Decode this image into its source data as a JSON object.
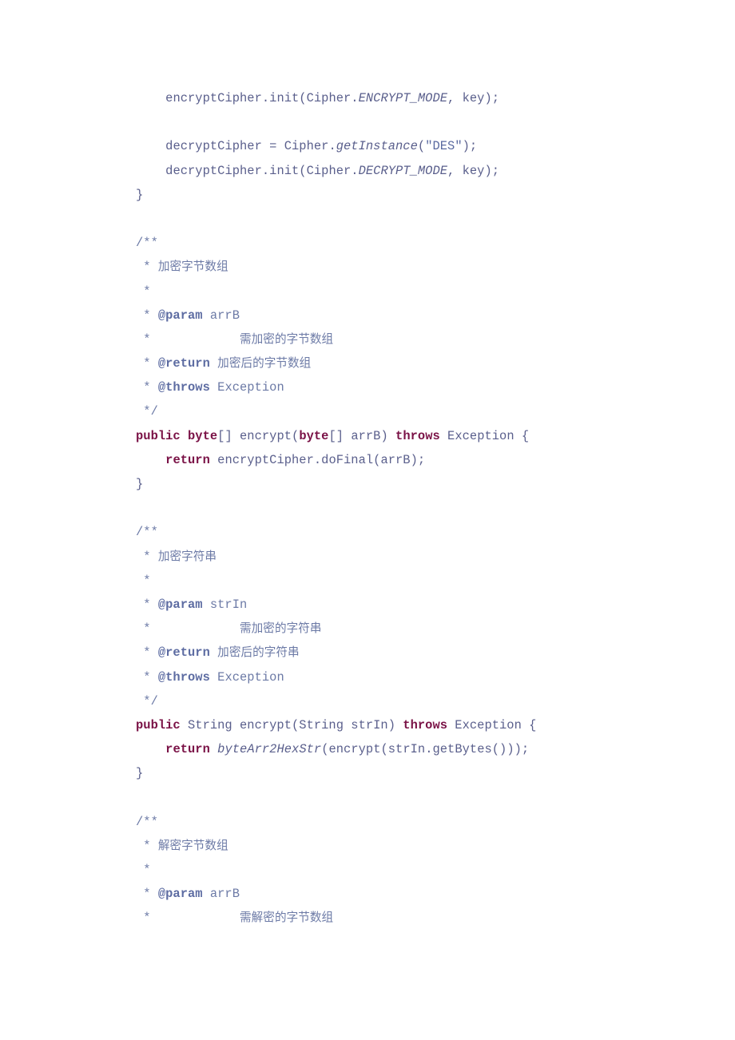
{
  "document": {
    "kind": "source-code-listing",
    "language": "Java",
    "background_color": "#ffffff",
    "colors": {
      "code": "#5a5f8c",
      "keyword": "#7a1246",
      "comment": "#6c7aa6",
      "comment_tag": "#5d6ca2",
      "string": "#5a6aa0"
    }
  },
  "lines": [
    {
      "id": "l01",
      "indent": 1,
      "tokens": [
        {
          "text": "encryptCipher.init(Cipher.",
          "style": "plain"
        },
        {
          "text": "ENCRYPT_MODE",
          "style": "static"
        },
        {
          "text": ", key);",
          "style": "plain"
        }
      ]
    },
    {
      "id": "l02",
      "indent": 0,
      "tokens": []
    },
    {
      "id": "l03",
      "indent": 1,
      "tokens": [
        {
          "text": "decryptCipher = Cipher.",
          "style": "plain"
        },
        {
          "text": "getInstance",
          "style": "static"
        },
        {
          "text": "(",
          "style": "plain"
        },
        {
          "text": "\"DES\"",
          "style": "string"
        },
        {
          "text": ");",
          "style": "plain"
        }
      ]
    },
    {
      "id": "l04",
      "indent": 1,
      "tokens": [
        {
          "text": "decryptCipher.init(Cipher.",
          "style": "plain"
        },
        {
          "text": "DECRYPT_MODE",
          "style": "static"
        },
        {
          "text": ", key);",
          "style": "plain"
        }
      ]
    },
    {
      "id": "l05",
      "indent": 0,
      "tokens": [
        {
          "text": "}",
          "style": "plain"
        }
      ]
    },
    {
      "id": "l06",
      "indent": 0,
      "tokens": []
    },
    {
      "id": "l07",
      "indent": 0,
      "tokens": [
        {
          "text": "/**",
          "style": "comment"
        }
      ]
    },
    {
      "id": "l08",
      "indent": 0,
      "tokens": [
        {
          "text": " * ",
          "style": "comment"
        },
        {
          "text": "加密字节数组",
          "style": "comment-cjk"
        }
      ]
    },
    {
      "id": "l09",
      "indent": 0,
      "tokens": [
        {
          "text": " *",
          "style": "comment"
        }
      ]
    },
    {
      "id": "l10",
      "indent": 0,
      "tokens": [
        {
          "text": " * ",
          "style": "comment"
        },
        {
          "text": "@param",
          "style": "comment-tag"
        },
        {
          "text": " arrB",
          "style": "comment"
        }
      ]
    },
    {
      "id": "l11",
      "indent": 0,
      "tokens": [
        {
          "text": " *            ",
          "style": "comment"
        },
        {
          "text": "需加密的字节数组",
          "style": "comment-cjk"
        }
      ]
    },
    {
      "id": "l12",
      "indent": 0,
      "tokens": [
        {
          "text": " * ",
          "style": "comment"
        },
        {
          "text": "@return",
          "style": "comment-tag"
        },
        {
          "text": " ",
          "style": "comment"
        },
        {
          "text": "加密后的字节数组",
          "style": "comment-cjk"
        }
      ]
    },
    {
      "id": "l13",
      "indent": 0,
      "tokens": [
        {
          "text": " * ",
          "style": "comment"
        },
        {
          "text": "@throws",
          "style": "comment-tag"
        },
        {
          "text": " Exception",
          "style": "comment"
        }
      ]
    },
    {
      "id": "l14",
      "indent": 0,
      "tokens": [
        {
          "text": " */",
          "style": "comment"
        }
      ]
    },
    {
      "id": "l15",
      "indent": 0,
      "tokens": [
        {
          "text": "public byte",
          "style": "keyword"
        },
        {
          "text": "[] encrypt(",
          "style": "plain"
        },
        {
          "text": "byte",
          "style": "keyword"
        },
        {
          "text": "[] arrB) ",
          "style": "plain"
        },
        {
          "text": "throws",
          "style": "keyword"
        },
        {
          "text": " Exception {",
          "style": "plain"
        }
      ]
    },
    {
      "id": "l16",
      "indent": 1,
      "tokens": [
        {
          "text": "return",
          "style": "keyword"
        },
        {
          "text": " encryptCipher.doFinal(arrB);",
          "style": "plain"
        }
      ]
    },
    {
      "id": "l17",
      "indent": 0,
      "tokens": [
        {
          "text": "}",
          "style": "plain"
        }
      ]
    },
    {
      "id": "l18",
      "indent": 0,
      "tokens": []
    },
    {
      "id": "l19",
      "indent": 0,
      "tokens": [
        {
          "text": "/**",
          "style": "comment"
        }
      ]
    },
    {
      "id": "l20",
      "indent": 0,
      "tokens": [
        {
          "text": " * ",
          "style": "comment"
        },
        {
          "text": "加密字符串",
          "style": "comment-cjk"
        }
      ]
    },
    {
      "id": "l21",
      "indent": 0,
      "tokens": [
        {
          "text": " *",
          "style": "comment"
        }
      ]
    },
    {
      "id": "l22",
      "indent": 0,
      "tokens": [
        {
          "text": " * ",
          "style": "comment"
        },
        {
          "text": "@param",
          "style": "comment-tag"
        },
        {
          "text": " strIn",
          "style": "comment"
        }
      ]
    },
    {
      "id": "l23",
      "indent": 0,
      "tokens": [
        {
          "text": " *            ",
          "style": "comment"
        },
        {
          "text": "需加密的字符串",
          "style": "comment-cjk"
        }
      ]
    },
    {
      "id": "l24",
      "indent": 0,
      "tokens": [
        {
          "text": " * ",
          "style": "comment"
        },
        {
          "text": "@return",
          "style": "comment-tag"
        },
        {
          "text": " ",
          "style": "comment"
        },
        {
          "text": "加密后的字符串",
          "style": "comment-cjk"
        }
      ]
    },
    {
      "id": "l25",
      "indent": 0,
      "tokens": [
        {
          "text": " * ",
          "style": "comment"
        },
        {
          "text": "@throws",
          "style": "comment-tag"
        },
        {
          "text": " Exception",
          "style": "comment"
        }
      ]
    },
    {
      "id": "l26",
      "indent": 0,
      "tokens": [
        {
          "text": " */",
          "style": "comment"
        }
      ]
    },
    {
      "id": "l27",
      "indent": 0,
      "tokens": [
        {
          "text": "public",
          "style": "keyword"
        },
        {
          "text": " String encrypt(String strIn) ",
          "style": "plain"
        },
        {
          "text": "throws",
          "style": "keyword"
        },
        {
          "text": " Exception {",
          "style": "plain"
        }
      ]
    },
    {
      "id": "l28",
      "indent": 1,
      "tokens": [
        {
          "text": "return",
          "style": "keyword"
        },
        {
          "text": " ",
          "style": "plain"
        },
        {
          "text": "byteArr2HexStr",
          "style": "static"
        },
        {
          "text": "(encrypt(strIn.getBytes()));",
          "style": "plain"
        }
      ]
    },
    {
      "id": "l29",
      "indent": 0,
      "tokens": [
        {
          "text": "}",
          "style": "plain"
        }
      ]
    },
    {
      "id": "l30",
      "indent": 0,
      "tokens": []
    },
    {
      "id": "l31",
      "indent": 0,
      "tokens": [
        {
          "text": "/**",
          "style": "comment"
        }
      ]
    },
    {
      "id": "l32",
      "indent": 0,
      "tokens": [
        {
          "text": " * ",
          "style": "comment"
        },
        {
          "text": "解密字节数组",
          "style": "comment-cjk"
        }
      ]
    },
    {
      "id": "l33",
      "indent": 0,
      "tokens": [
        {
          "text": " *",
          "style": "comment"
        }
      ]
    },
    {
      "id": "l34",
      "indent": 0,
      "tokens": [
        {
          "text": " * ",
          "style": "comment"
        },
        {
          "text": "@param",
          "style": "comment-tag"
        },
        {
          "text": " arrB",
          "style": "comment"
        }
      ]
    },
    {
      "id": "l35",
      "indent": 0,
      "tokens": [
        {
          "text": " *            ",
          "style": "comment"
        },
        {
          "text": "需解密的字节数组",
          "style": "comment-cjk"
        }
      ]
    }
  ]
}
